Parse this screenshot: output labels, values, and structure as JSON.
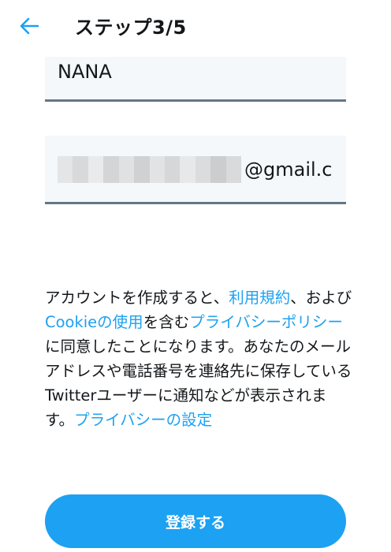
{
  "header": {
    "back_icon": "arrow-left-icon",
    "title": "ステップ3/5"
  },
  "form": {
    "name_value": "NANA",
    "email_value_visible": "@gmail.c",
    "email_redacted": true
  },
  "terms": {
    "t1": "アカウントを作成すると、",
    "link_tos": "利用規約",
    "t2": "、および",
    "link_cookie": "Cookieの使用",
    "t3": "を含む",
    "link_privacy": "プライバシーポリシー",
    "t4": "に同意したことになります。あなたのメールアドレスや電話番号を連絡先に保存しているTwitterユーザーに通知などが表示されます。",
    "link_privacy_settings": "プライバシーの設定"
  },
  "actions": {
    "signup_label": "登録する"
  },
  "colors": {
    "accent": "#1da1f2",
    "text": "#14171a",
    "field_bg": "#f5f8fa",
    "field_border": "#657786"
  }
}
